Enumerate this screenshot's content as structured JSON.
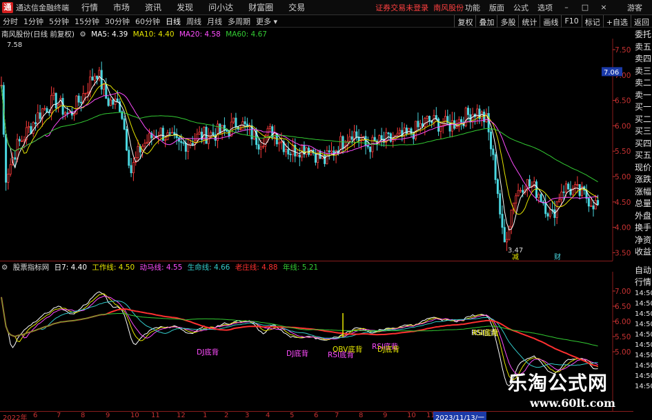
{
  "menubar": {
    "app_name": "通达信金融终端",
    "items": [
      "行情",
      "市场",
      "资讯",
      "发现",
      "问小达",
      "财富圈",
      "交易"
    ],
    "status": "证券交易未登录",
    "stock": "南风股份",
    "right_items": [
      "功能",
      "版面",
      "公式",
      "选项"
    ],
    "guest": "游客"
  },
  "toolbar": {
    "periods": [
      "分时",
      "1分钟",
      "5分钟",
      "15分钟",
      "30分钟",
      "60分钟",
      "日线",
      "周线",
      "月线",
      "多周期",
      "更多"
    ],
    "active_period": "日线",
    "tools": [
      "复权",
      "叠加",
      "多股",
      "统计",
      "画线",
      "F10",
      "标记",
      "+自选",
      "返回"
    ]
  },
  "main_legend": {
    "title": "南风股份(日线 前复权)",
    "ma5": "MA5: 4.39",
    "ma10": "MA10: 4.40",
    "ma20": "MA20: 4.58",
    "ma60": "MA60: 4.67",
    "colors": {
      "ma5": "#ffffff",
      "ma10": "#e5e500",
      "ma20": "#ff4dff",
      "ma60": "#33cc33"
    }
  },
  "indicator_legend": {
    "title": "股票指标网",
    "day7": "日7: 4.40",
    "work": "工作线: 4.50",
    "motion": "动马线: 4.55",
    "life": "生命线: 4.66",
    "old": "老庄线: 4.88",
    "year": "年线: 5.21",
    "colors": {
      "work": "#e5e500",
      "motion": "#ff4dff",
      "life": "#33cccc",
      "old": "#ff3030",
      "year": "#33cc33"
    }
  },
  "main_axis": {
    "labels": [
      "7.50",
      "7.00",
      "6.50",
      "6.00",
      "5.50",
      "5.00",
      "4.50",
      "4.00",
      "3.50"
    ],
    "current_price": "7.06",
    "high_label": "7.58",
    "low_label": "3.47",
    "marks": [
      "减",
      "财"
    ]
  },
  "ind_axis": {
    "labels": [
      "7.00",
      "6.50",
      "6.00",
      "5.50",
      "5.00"
    ]
  },
  "signals": [
    "DJ底背",
    "DJ底背",
    "RSI底背",
    "OBV底背",
    "RSI底背",
    "DJ底背",
    "RSI底背",
    "RSI底背"
  ],
  "side_tabs": [
    "委托",
    "卖五",
    "卖四",
    "卖三",
    "卖二",
    "卖一",
    "买一",
    "买二",
    "买三",
    "买四",
    "买五",
    "现价",
    "涨跌",
    "涨幅",
    "总量",
    "外盘",
    "换手",
    "净资",
    "收益"
  ],
  "side_tabs2": [
    "自动",
    "行情"
  ],
  "side_times": [
    "14:50",
    "14:50",
    "14:50",
    "14:50",
    "14:50",
    "14:50",
    "14:50",
    "14:50",
    "14:50",
    "14:50"
  ],
  "date_axis": {
    "labels": [
      "2022年",
      "6",
      "7",
      "8",
      "9",
      "10",
      "11",
      "12",
      "1",
      "2",
      "3",
      "4",
      "5",
      "6",
      "7",
      "8",
      "9",
      "10",
      "11"
    ],
    "cursor": "2023/11/13/一"
  },
  "watermark": {
    "title": "乐淘公式网",
    "url": "www.60lt.com"
  },
  "colors": {
    "up": "#ff3b3b",
    "down": "#4ad7e0",
    "axis": "#c83232",
    "bg": "#000000"
  }
}
